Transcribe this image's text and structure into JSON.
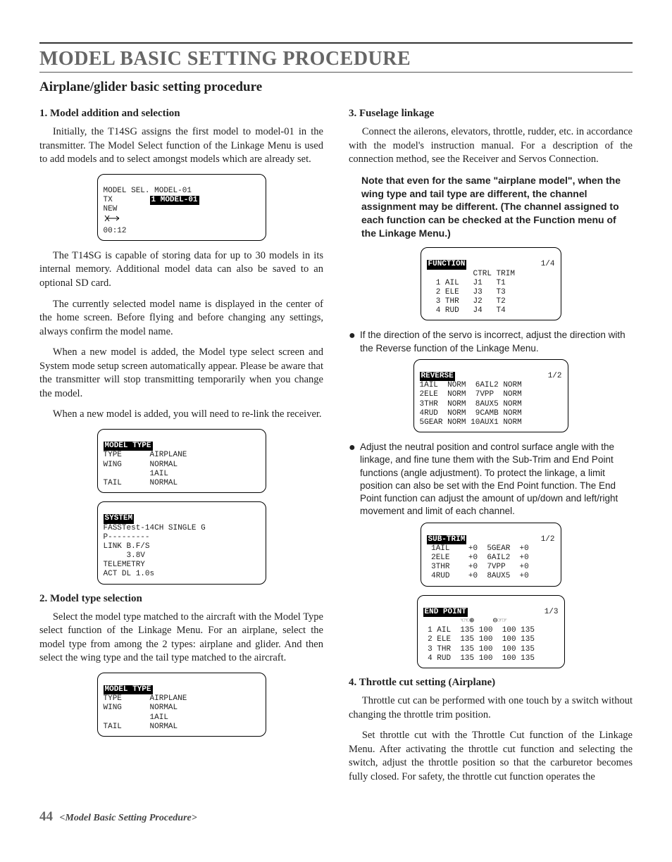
{
  "header": {
    "title": "MODEL BASIC SETTING PROCEDURE",
    "subtitle": "Airplane/glider basic setting procedure"
  },
  "left": {
    "step1": {
      "heading": "1. Model addition and selection",
      "p1": "Initially, the T14SG assigns the first model to model-01 in the transmitter. The Model Select function of the Linkage Menu is used to add models and to select amongst models which are already set.",
      "p2": "The T14SG is capable of storing data for up to 30 models  in its internal memory. Additional model data can also be saved to an optional SD card.",
      "p3": "The currently selected model name is displayed in the center of the home screen. Before flying and before changing any settings, always confirm the model name.",
      "p4": "When a new model is added, the Model type select screen and System mode setup screen automatically appear. Please be  aware that the transmitter will stop transmitting temporarily when you change the model.",
      "p5": "When a new model is added, you will need to re-link the receiver."
    },
    "step2": {
      "heading": "2. Model type selection",
      "p1": "Select the model type matched to the aircraft with the Model Type select function of the Linkage Menu. For an airplane, select the model type from among the 2 types: airplane and glider. And then select the wing type and the tail type matched to the aircraft."
    },
    "lcd_model_sel": {
      "title": "MODEL SEL.",
      "model": "MODEL-01",
      "rows": [
        "TX",
        "NEW"
      ],
      "selected": "1 MODEL-01",
      "time": "00:12"
    },
    "lcd_model_type_a": {
      "title": "MODEL TYPE",
      "rows": [
        [
          "TYPE",
          "AIRPLANE"
        ],
        [
          "WING",
          "NORMAL"
        ],
        [
          "",
          "1AIL"
        ],
        [
          "TAIL",
          "NORMAL"
        ]
      ]
    },
    "lcd_system": {
      "title": "SYSTEM",
      "lines": [
        "FASSTest-14CH SINGLE G",
        "P---------",
        "LINK B.F/S",
        "     3.8V",
        "TELEMETRY",
        "ACT DL 1.0s"
      ]
    },
    "lcd_model_type_b": {
      "title": "MODEL TYPE",
      "rows": [
        [
          "TYPE",
          "AIRPLANE"
        ],
        [
          "WING",
          "NORMAL"
        ],
        [
          "",
          "1AIL"
        ],
        [
          "TAIL",
          "NORMAL"
        ]
      ]
    }
  },
  "right": {
    "step3": {
      "heading": "3. Fuselage linkage",
      "p1": "Connect the ailerons, elevators, throttle, rudder, etc. in accordance with the model's instruction manual. For a description of the connection method, see the Receiver and Servos Connection.",
      "note": "Note that even for the same \"airplane model\", when the wing type and tail type are different, the channel assignment may be different. (The channel assigned to each function can be checked at the Function menu of the Linkage Menu.)",
      "bullet1": "If the direction of the servo is incorrect, adjust the direction with the Reverse function of the Linkage Menu.",
      "bullet2": "Adjust the neutral position and control surface angle with the linkage, and fine tune them with the Sub-Trim and End Point functions (angle adjustment). To protect the linkage, a limit position can also be set with the End Point function. The End Point function can adjust the amount of up/down and left/right movement and limit of each channel."
    },
    "lcd_function": {
      "title": "FUNCTION",
      "page": "1/4",
      "header": [
        "",
        "CTRL",
        "TRIM"
      ],
      "rows": [
        [
          "1 AIL",
          "J1",
          "T1"
        ],
        [
          "2 ELE",
          "J3",
          "T3"
        ],
        [
          "3 THR",
          "J2",
          "T2"
        ],
        [
          "4 RUD",
          "J4",
          "T4"
        ]
      ]
    },
    "lcd_reverse": {
      "title": "REVERSE",
      "page": "1/2",
      "rows": [
        "1AIL  NORM  6AIL2 NORM",
        "2ELE  NORM  7VPP  NORM",
        "3THR  NORM  8AUX5 NORM",
        "4RUD  NORM  9CAMB NORM",
        "5GEAR NORM 10AUX1 NORM"
      ]
    },
    "lcd_subtrim": {
      "title": "SUB-TRIM",
      "page": "1/2",
      "rows": [
        [
          "1AIL",
          "+0",
          "5GEAR",
          "+0"
        ],
        [
          "2ELE",
          "+0",
          "6AIL2",
          "+0"
        ],
        [
          "3THR",
          "+0",
          "7VPP",
          "+0"
        ],
        [
          "4RUD",
          "+0",
          "8AUX5",
          "+0"
        ]
      ]
    },
    "lcd_endpoint": {
      "title": "END POINT",
      "page": "1/3",
      "arrows_left": "☜☜⊕",
      "arrows_right": "⊖☞☞",
      "rows": [
        [
          "1 AIL",
          "135 100",
          "100 135"
        ],
        [
          "2 ELE",
          "135 100",
          "100 135"
        ],
        [
          "3 THR",
          "135 100",
          "100 135"
        ],
        [
          "4 RUD",
          "135 100",
          "100 135"
        ]
      ]
    },
    "step4": {
      "heading": "4. Throttle cut setting (Airplane)",
      "p1": "Throttle cut can be performed with one touch by a switch without changing the throttle trim position.",
      "p2": "Set throttle cut with the Throttle Cut function of the Linkage Menu. After activating the throttle cut function and selecting the switch, adjust the throttle position so that the carburetor becomes fully closed. For safety, the throttle cut function operates the"
    }
  },
  "footer": {
    "page": "44",
    "label": "<Model Basic Setting Procedure>"
  }
}
